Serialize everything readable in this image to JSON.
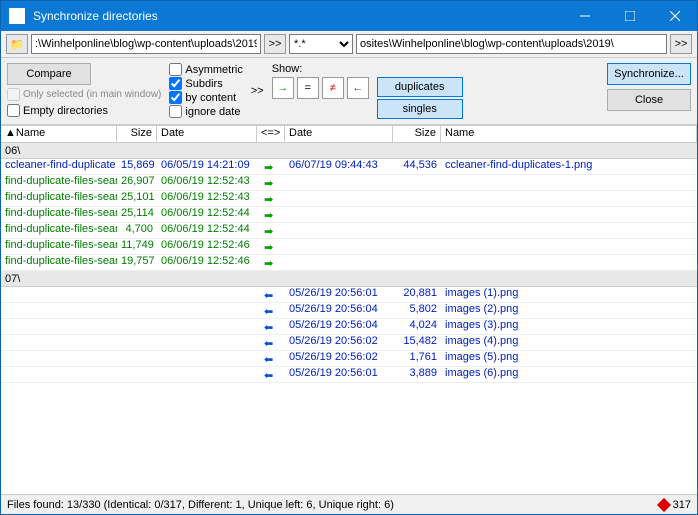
{
  "window": {
    "title": "Synchronize directories"
  },
  "paths": {
    "left": ":\\Winhelponline\\blog\\wp-content\\uploads\\2019\\",
    "filter": "*.*",
    "right": "osites\\Winhelponline\\blog\\wp-content\\uploads\\2019\\"
  },
  "toolbar": {
    "compare": "Compare",
    "only_selected": "Only selected (in main window)",
    "empty_dirs": "Empty directories",
    "asymmetric": "Asymmetric",
    "subdirs": "Subdirs",
    "by_content": "by content",
    "ignore_date": "ignore date",
    "show": "Show:",
    "duplicates": "duplicates",
    "singles": "singles",
    "synchronize": "Synchronize...",
    "close": "Close"
  },
  "columns": {
    "name": "Name",
    "size": "Size",
    "date": "Date",
    "dir": "<=>",
    "date2": "Date",
    "size2": "Size",
    "name2": "Name"
  },
  "groups": [
    {
      "label": "06\\",
      "rows": [
        {
          "ln": "ccleaner-find-duplicate",
          "ls": "15,869",
          "ld": "06/05/19 14:21:09",
          "dir": "right",
          "rd": "06/07/19 09:44:43",
          "rs": "44,536",
          "rn": "ccleaner-find-duplicates-1.png",
          "color": "blue"
        },
        {
          "ln": "find-duplicate-files-sear",
          "ls": "26,907",
          "ld": "06/06/19 12:52:43",
          "dir": "right",
          "rd": "",
          "rs": "",
          "rn": "",
          "color": "green"
        },
        {
          "ln": "find-duplicate-files-sear",
          "ls": "25,101",
          "ld": "06/06/19 12:52:43",
          "dir": "right",
          "rd": "",
          "rs": "",
          "rn": "",
          "color": "green"
        },
        {
          "ln": "find-duplicate-files-sear",
          "ls": "25,114",
          "ld": "06/06/19 12:52:44",
          "dir": "right",
          "rd": "",
          "rs": "",
          "rn": "",
          "color": "green"
        },
        {
          "ln": "find-duplicate-files-searcl",
          "ls": "4,700",
          "ld": "06/06/19 12:52:44",
          "dir": "right",
          "rd": "",
          "rs": "",
          "rn": "",
          "color": "green"
        },
        {
          "ln": "find-duplicate-files-sear",
          "ls": "11,749",
          "ld": "06/06/19 12:52:46",
          "dir": "right",
          "rd": "",
          "rs": "",
          "rn": "",
          "color": "green"
        },
        {
          "ln": "find-duplicate-files-sear",
          "ls": "19,757",
          "ld": "06/06/19 12:52:46",
          "dir": "right",
          "rd": "",
          "rs": "",
          "rn": "",
          "color": "green"
        }
      ]
    },
    {
      "label": "07\\",
      "rows": [
        {
          "ln": "",
          "ls": "",
          "ld": "",
          "dir": "left",
          "rd": "05/26/19 20:56:01",
          "rs": "20,881",
          "rn": "images (1).png",
          "color": "blue"
        },
        {
          "ln": "",
          "ls": "",
          "ld": "",
          "dir": "left",
          "rd": "05/26/19 20:56:04",
          "rs": "5,802",
          "rn": "images (2).png",
          "color": "blue"
        },
        {
          "ln": "",
          "ls": "",
          "ld": "",
          "dir": "left",
          "rd": "05/26/19 20:56:04",
          "rs": "4,024",
          "rn": "images (3).png",
          "color": "blue"
        },
        {
          "ln": "",
          "ls": "",
          "ld": "",
          "dir": "left",
          "rd": "05/26/19 20:56:02",
          "rs": "15,482",
          "rn": "images (4).png",
          "color": "blue"
        },
        {
          "ln": "",
          "ls": "",
          "ld": "",
          "dir": "left",
          "rd": "05/26/19 20:56:02",
          "rs": "1,761",
          "rn": "images (5).png",
          "color": "blue"
        },
        {
          "ln": "",
          "ls": "",
          "ld": "",
          "dir": "left",
          "rd": "05/26/19 20:56:01",
          "rs": "3,889",
          "rn": "images (6).png",
          "color": "blue"
        }
      ]
    }
  ],
  "status": {
    "text": "Files found: 13/330  (Identical: 0/317, Different: 1, Unique left: 6, Unique right: 6)",
    "count": "317"
  }
}
